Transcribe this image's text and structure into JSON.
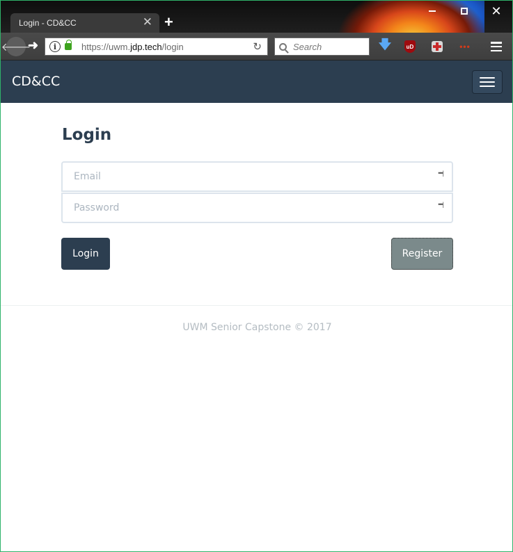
{
  "browser": {
    "tab_title": "Login - CD&CC",
    "tab_close": "✕",
    "new_tab": "+",
    "url_prefix": "https://uwm.",
    "url_domain": "jdp.tech",
    "url_path": "/login",
    "search_placeholder": "Search",
    "ublock_label": "uD"
  },
  "navbar": {
    "brand": "CD&CC"
  },
  "login": {
    "title": "Login",
    "email_placeholder": "Email",
    "password_placeholder": "Password",
    "login_button": "Login",
    "register_button": "Register"
  },
  "footer": {
    "text": "UWM Senior Capstone © 2017"
  },
  "colors": {
    "navbar": "#2c3e50",
    "primary_button": "#2c3e50",
    "secondary_button": "#7b8a8b"
  }
}
